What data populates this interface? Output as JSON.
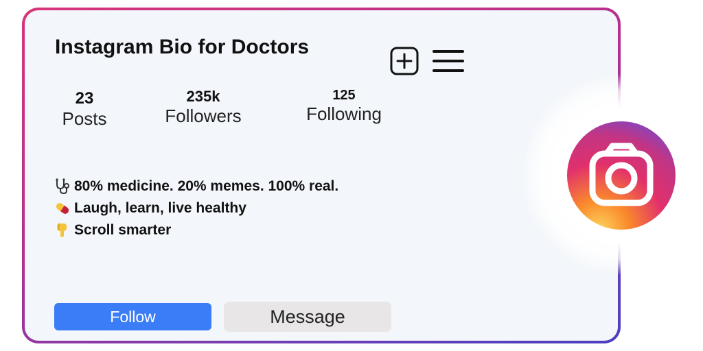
{
  "profile": {
    "title": "Instagram Bio for Doctors"
  },
  "stats": {
    "posts": {
      "count": "23",
      "label": "Posts"
    },
    "followers": {
      "count": "235k",
      "label": "Followers"
    },
    "following": {
      "count": "125",
      "label": "Following"
    }
  },
  "bio": {
    "lines": [
      {
        "icon": "stethoscope-icon",
        "text": "80% medicine. 20% memes. 100% real."
      },
      {
        "icon": "pill-icon",
        "text": "Laugh, learn, live healthy"
      },
      {
        "icon": "pointing-down-icon",
        "text": "Scroll smarter"
      }
    ]
  },
  "actions": {
    "follow_label": "Follow",
    "message_label": "Message"
  },
  "icons": {
    "new_post": "plus-square-icon",
    "menu": "hamburger-menu-icon",
    "brand": "instagram-logo-icon"
  },
  "colors": {
    "follow_button": "#3b7cf7",
    "message_button": "#e8e6e6",
    "card_background": "#f3f6fa",
    "border_start": "#d6357a",
    "border_end": "#4a3fbf"
  }
}
